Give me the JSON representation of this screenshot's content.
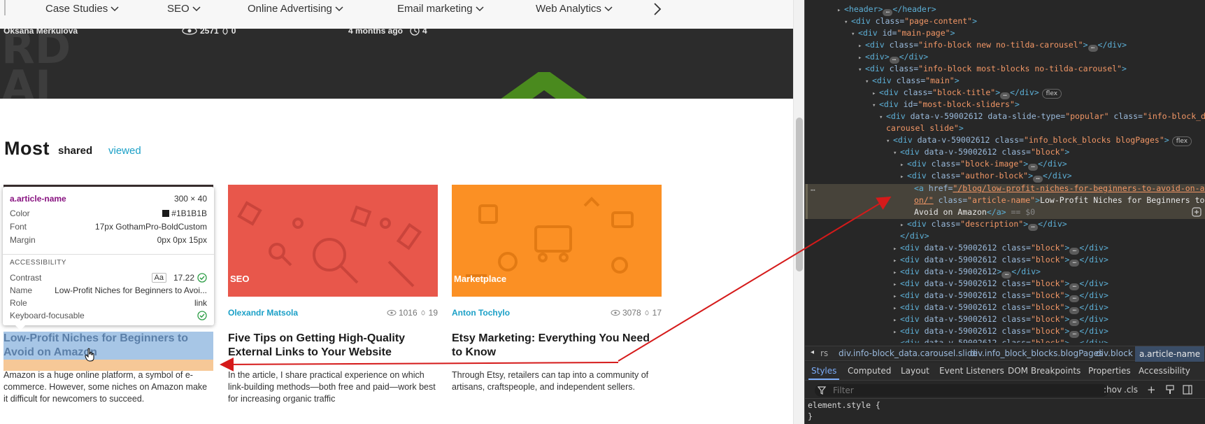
{
  "nav": {
    "items": [
      {
        "label": "Case Studies"
      },
      {
        "label": "SEO"
      },
      {
        "label": "Online Advertising"
      },
      {
        "label": "Email marketing"
      },
      {
        "label": "Web Analytics"
      }
    ]
  },
  "hero": {
    "author": "Oksana Merkulova",
    "views": "2571",
    "likes": "0",
    "time_ago": "4 months ago",
    "reading_time": "4",
    "bg_text": "RD\nAI"
  },
  "most": {
    "title": "Most",
    "tab_shared": "shared",
    "tab_viewed": "viewed"
  },
  "cards": [
    {
      "category": "",
      "author": "",
      "views": "",
      "likes": "",
      "title": "Low-Profit Niches for Beginners to Avoid on Amazon",
      "description": "Amazon is a huge online platform, a symbol of e-commerce. However, some niches on Amazon make it difficult for newcomers to succeed."
    },
    {
      "category": "SEO",
      "author": "Olexandr Matsola",
      "views": "1016",
      "likes": "19",
      "title": "Five Tips on Getting High-Quality External Links to Your Website",
      "description": "In the article, I share practical experience on which link-building methods—both free and paid—work best for increasing organic traffic"
    },
    {
      "category": "Marketplace",
      "author": "Anton Tochylo",
      "views": "3078",
      "likes": "17",
      "title": "Etsy Marketing: Everything You Need to Know",
      "description": "Through Etsy, retailers can tap into a community of artisans, craftspeople, and independent sellers."
    }
  ],
  "tooltip": {
    "selector": "a.article-name",
    "size": "300 × 40",
    "color_label": "Color",
    "color_value": "#1B1B1B",
    "font_label": "Font",
    "font_value": "17px GothamPro-BoldCustom",
    "margin_label": "Margin",
    "margin_value": "0px 0px 15px",
    "section": "ACCESSIBILITY",
    "contrast_label": "Contrast",
    "contrast_aa": "Aa",
    "contrast_value": "17.22",
    "name_label": "Name",
    "name_value": "Low-Profit Niches for Beginners to Avoi...",
    "role_label": "Role",
    "role_value": "link",
    "kb_label": "Keyboard-focusable"
  },
  "devtools": {
    "lines": [
      {
        "tw": "▸",
        "pre": "",
        "tag": "<header>",
        "dots": true,
        "post": "</header>"
      },
      {
        "tw": "▾",
        "pre": "",
        "tag": "<div ",
        "attr": "class",
        "val": "\"page-content\"",
        "close": ">"
      },
      {
        "tw": "▾",
        "pre": "",
        "tag": "<div ",
        "attr": "id",
        "val": "\"main-page\"",
        "close": ">"
      },
      {
        "tw": "▸",
        "pre": "",
        "tag": "<div ",
        "attr": "class",
        "val": "\"info-block new no-tilda-carousel\"",
        "close": ">",
        "dots": true,
        "post": "</div>"
      },
      {
        "tw": "▸",
        "pre": "",
        "tag": "<div>",
        "dots": true,
        "post": "</div>"
      },
      {
        "tw": "▾",
        "pre": "",
        "tag": "<div ",
        "attr": "class",
        "val": "\"info-block most-blocks no-tilda-carousel\"",
        "close": ">"
      },
      {
        "tw": "▾",
        "pre": "",
        "tag": "<div ",
        "attr": "class",
        "val": "\"main\"",
        "close": ">"
      },
      {
        "tw": "▸",
        "pre": "",
        "tag": "<div ",
        "attr": "class",
        "val": "\"block-title\"",
        "close": ">",
        "dots": true,
        "post": "</div>",
        "badge": "flex"
      },
      {
        "tw": "▾",
        "pre": "",
        "tag": "<div ",
        "attr": "id",
        "val": "\"most-block-sliders\"",
        "close": ">"
      },
      {
        "tw": "▾",
        "pre": "",
        "tag": "<div ",
        "attr": "data-v-59002612 data-slide-type",
        "val": "\"popular\"",
        "attr2": " class",
        "val2": "\"info-block_data",
        "close": ""
      },
      {
        "tw": "",
        "pre": "",
        "tag": "",
        "val": "carousel slide\"",
        "close": ">"
      },
      {
        "tw": "▾",
        "pre": "",
        "tag": "<div ",
        "attr": "data-v-59002612 class",
        "val": "\"info_block_blocks blogPages\"",
        "close": ">",
        "badge": "flex"
      },
      {
        "tw": "▾",
        "pre": "",
        "tag": "<div ",
        "attr": "data-v-59002612 class",
        "val": "\"block\"",
        "close": ">"
      },
      {
        "tw": "▸",
        "pre": "",
        "tag": "<div ",
        "attr": "class",
        "val": "\"block-image\"",
        "close": ">",
        "dots": true,
        "post": "</div>"
      },
      {
        "tw": "▸",
        "pre": "",
        "tag": "<div ",
        "attr": "class",
        "val": "\"author-block\"",
        "close": ">",
        "dots": true,
        "post": "</div>"
      },
      {
        "tw": "",
        "pre": "",
        "tag": "<a ",
        "attr": "href",
        "link": "\"/blog/low-profit-niches-for-beginners-to-avoid-on-amaz",
        "close": ""
      },
      {
        "tw": "",
        "pre": "",
        "tag": "",
        "link": "on/\"",
        "attr2": " class",
        "val2": "\"article-name\"",
        "close": ">",
        "text": "Low-Profit Niches for Beginners to"
      },
      {
        "tw": "",
        "pre": "",
        "tag": "",
        "text": "Avoid on Amazon",
        "post": "</a>",
        "eq": " == $0"
      },
      {
        "tw": "▸",
        "pre": "",
        "tag": "<div ",
        "attr": "class",
        "val": "\"description\"",
        "close": ">",
        "dots": true,
        "post": "</div>"
      },
      {
        "tw": "",
        "pre": "",
        "tag": "</div>"
      },
      {
        "tw": "▸",
        "pre": "",
        "tag": "<div ",
        "attr": "data-v-59002612 class",
        "val": "\"block\"",
        "close": ">",
        "dots": true,
        "post": "</div>"
      },
      {
        "tw": "▸",
        "pre": "",
        "tag": "<div ",
        "attr": "data-v-59002612 class",
        "val": "\"block\"",
        "close": ">",
        "dots": true,
        "post": "</div>"
      },
      {
        "tw": "▸",
        "pre": "",
        "tag": "<div ",
        "attr": "data-v-59002612",
        "close": ">",
        "dots": true,
        "post": "</div>"
      },
      {
        "tw": "▸",
        "pre": "",
        "tag": "<div ",
        "attr": "data-v-59002612 class",
        "val": "\"block\"",
        "close": ">",
        "dots": true,
        "post": "</div>"
      },
      {
        "tw": "▸",
        "pre": "",
        "tag": "<div ",
        "attr": "data-v-59002612 class",
        "val": "\"block\"",
        "close": ">",
        "dots": true,
        "post": "</div>"
      },
      {
        "tw": "▸",
        "pre": "",
        "tag": "<div ",
        "attr": "data-v-59002612 class",
        "val": "\"block\"",
        "close": ">",
        "dots": true,
        "post": "</div>"
      },
      {
        "tw": "▸",
        "pre": "",
        "tag": "<div ",
        "attr": "data-v-59002612 class",
        "val": "\"block\"",
        "close": ">",
        "dots": true,
        "post": "</div>"
      },
      {
        "tw": "▸",
        "pre": "",
        "tag": "<div ",
        "attr": "data-v-59002612 class",
        "val": "\"block\"",
        "close": ">",
        "dots": true,
        "post": "</div>"
      },
      {
        "tw": "▸",
        "pre": "",
        "tag": "<div ",
        "attr": "data-v-59002612 class",
        "val": "\"block\"",
        "close": ">",
        "dots": true,
        "post": "</div>"
      }
    ],
    "breadcrumbs": [
      "rs",
      "div.info-block_data.carousel.slide",
      "div.info_block_blocks.blogPages",
      "div.block",
      "a.article-name"
    ],
    "tabs": [
      "Styles",
      "Computed",
      "Layout",
      "Event Listeners",
      "DOM Breakpoints",
      "Properties",
      "Accessibility"
    ],
    "filter_placeholder": "Filter",
    "hov": ":hov",
    "cls": ".cls",
    "element_style": "element.style {",
    "element_style_close": "}"
  },
  "colors": {
    "link_blue": "#1ba0c7",
    "seo_card": "#e8574b",
    "marketplace_card": "#fb9024",
    "arrow_red": "#d51a1a",
    "highlight_blue": "#a7c6e6",
    "highlight_orange": "#f6c897"
  }
}
